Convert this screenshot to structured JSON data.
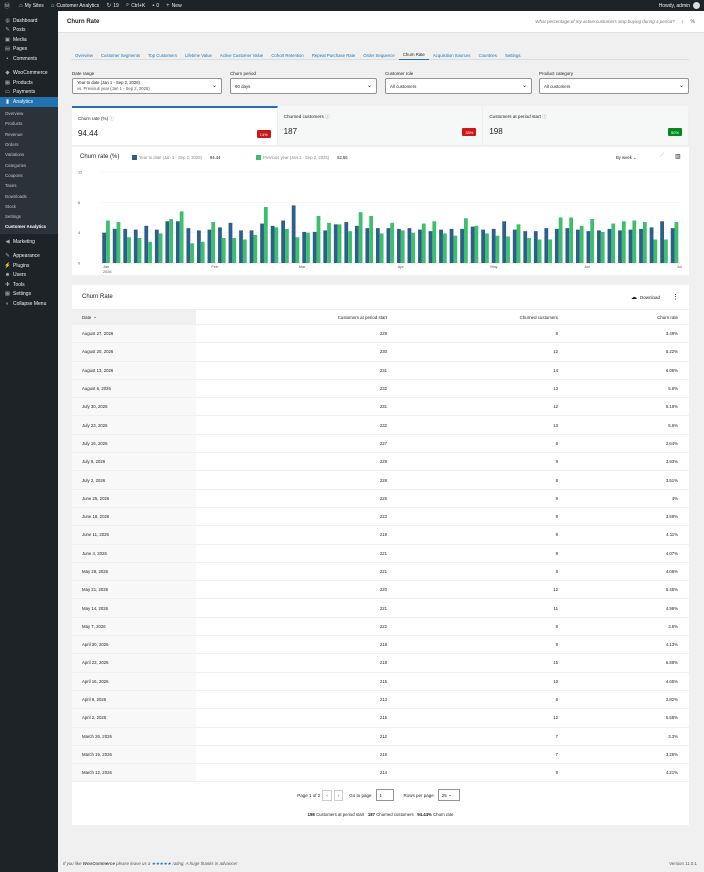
{
  "admin_bar": {
    "my_sites": "My Sites",
    "site_name": "Customer Analytics",
    "updates": "19",
    "search": "Ctrl+K",
    "comments": "0",
    "new": "New",
    "howdy": "Howdy, admin"
  },
  "sidebar": {
    "items": [
      {
        "label": "Dashboard",
        "icon": "dashboard-icon"
      },
      {
        "label": "Posts",
        "icon": "pin-icon"
      },
      {
        "label": "Media",
        "icon": "media-icon"
      },
      {
        "label": "Pages",
        "icon": "page-icon"
      },
      {
        "label": "Comments",
        "icon": "comment-icon"
      },
      {
        "label": "WooCommerce",
        "icon": "woo-icon"
      },
      {
        "label": "Products",
        "icon": "products-icon"
      },
      {
        "label": "Payments",
        "icon": "payments-icon"
      },
      {
        "label": "Analytics",
        "icon": "analytics-icon"
      }
    ],
    "submenu": [
      "Overview",
      "Products",
      "Revenue",
      "Orders",
      "Variations",
      "Categories",
      "Coupons",
      "Taxes",
      "Downloads",
      "Stock",
      "Settings",
      "Customer Analytics"
    ],
    "items2": [
      {
        "label": "Marketing",
        "icon": "megaphone-icon"
      },
      {
        "label": "Appearance",
        "icon": "brush-icon"
      },
      {
        "label": "Plugins",
        "icon": "plugin-icon"
      },
      {
        "label": "Users",
        "icon": "users-icon"
      },
      {
        "label": "Tools",
        "icon": "tools-icon"
      },
      {
        "label": "Settings",
        "icon": "settings-icon"
      },
      {
        "label": "Collapse Menu",
        "icon": "collapse-icon"
      }
    ]
  },
  "header": {
    "title": "Churn Rate",
    "question": "What percentage of my active customers stop buying during a period?"
  },
  "tabs": [
    "Overview",
    "Customer Segments",
    "Top Customers",
    "Lifetime Value",
    "Active Customer Value",
    "Cohort Retention",
    "Repeat Purchase Rate",
    "Order Sequence",
    "Churn Rate",
    "Acquisition Sources",
    "Countries",
    "Settings"
  ],
  "active_tab": "Churn Rate",
  "filters": {
    "date_range": {
      "label": "Date range",
      "line1": "Year to date (Jan 1 - Sep 2, 2026)",
      "line2": "vs. Previous year (Jan 1 - Sep 2, 2025)"
    },
    "churn_period": {
      "label": "Churn period",
      "value": "90 days"
    },
    "customer_role": {
      "label": "Customer role",
      "value": "All customers"
    },
    "product_category": {
      "label": "Product category",
      "value": "All customers"
    }
  },
  "kpis": [
    {
      "label": "Churn rate (%)",
      "value": "94.44",
      "delta": "14%",
      "delta_color": "#cc1818"
    },
    {
      "label": "Churned customers",
      "value": "187",
      "delta": "33%",
      "delta_color": "#cc1818"
    },
    {
      "label": "Customers at period start",
      "value": "198",
      "delta": "50%",
      "delta_color": "#008a20"
    }
  ],
  "chart": {
    "title": "Churn rate (%)",
    "period": "By week",
    "colors": {
      "current": "#2c5f8a",
      "previous": "#3dbf6e"
    }
  },
  "chart_data": {
    "type": "bar",
    "series": [
      {
        "name": "Year to date (Jan 1 - Sep 2, 2026)",
        "total": "94.44",
        "values": [
          4,
          4.5,
          4.5,
          4.4,
          4.9,
          4.4,
          5.5,
          5.5,
          4.6,
          4.3,
          4.4,
          4.7,
          5.3,
          4.3,
          4.3,
          5.2,
          4.9,
          5.6,
          7.6,
          4.1,
          4.1,
          4.3,
          5.1,
          5.4,
          4.9,
          4.6,
          4.6,
          4.6,
          4.5,
          4.6,
          4.4,
          4.2,
          4.4,
          4.5,
          4.5,
          4.8,
          4.4,
          4.5,
          5.5,
          4.4,
          4.2,
          4.2,
          4.6,
          4.5,
          4.6,
          4.4,
          4.2,
          4.3,
          4.5,
          4.3,
          4.4,
          4.5,
          4.7,
          5.5,
          4.6
        ]
      },
      {
        "name": "Previous year (Jan 1 - Sep 2, 2025)",
        "total": "82.56",
        "values": [
          5.6,
          5.4,
          3.4,
          3.3,
          2.8,
          3.9,
          5.8,
          6.8,
          2.6,
          2.8,
          5.4,
          3.3,
          3.3,
          3.1,
          3.7,
          7.4,
          4.7,
          4.5,
          3.4,
          4.0,
          6.2,
          5.3,
          5.1,
          4.2,
          6.7,
          6.2,
          3.9,
          5.3,
          4.3,
          4.0,
          5.2,
          5.5,
          3.9,
          3.6,
          5.9,
          4.9,
          3.9,
          3.6,
          3.5,
          5.1,
          3.3,
          3.1,
          3.1,
          6.0,
          6.0,
          4.9,
          5.8,
          4.1,
          5.2,
          5.5,
          5.6,
          5.4,
          3.1,
          3.1,
          5.4
        ]
      }
    ],
    "x_labels": [
      "Jan\n2026",
      "Feb",
      "Mar",
      "Apr",
      "May",
      "Jun",
      "Jul",
      "Aug"
    ],
    "y_ticks": [
      0,
      4,
      8,
      12
    ],
    "ylim": [
      0,
      12
    ]
  },
  "table": {
    "title": "Churn Rate",
    "download": "Download",
    "columns": [
      "Date",
      "Customers at period start",
      "Churned customers",
      "Churn rate"
    ],
    "rows": [
      [
        "August 27, 2026",
        "229",
        "8",
        "3.49%"
      ],
      [
        "August 20, 2026",
        "230",
        "12",
        "5.22%"
      ],
      [
        "August 13, 2026",
        "231",
        "14",
        "6.06%"
      ],
      [
        "August 6, 2026",
        "232",
        "13",
        "5.6%"
      ],
      [
        "July 30, 2026",
        "231",
        "12",
        "5.19%"
      ],
      [
        "July 23, 2026",
        "232",
        "13",
        "5.6%"
      ],
      [
        "July 16, 2026",
        "227",
        "6",
        "2.64%"
      ],
      [
        "July 9, 2026",
        "229",
        "9",
        "3.93%"
      ],
      [
        "July 2, 2026",
        "228",
        "8",
        "3.51%"
      ],
      [
        "June 25, 2026",
        "225",
        "9",
        "4%"
      ],
      [
        "June 18, 2026",
        "223",
        "8",
        "3.59%"
      ],
      [
        "June 11, 2026",
        "219",
        "9",
        "4.11%"
      ],
      [
        "June 4, 2026",
        "221",
        "9",
        "4.07%"
      ],
      [
        "May 28, 2026",
        "221",
        "9",
        "4.08%"
      ],
      [
        "May 21, 2026",
        "220",
        "12",
        "5.45%"
      ],
      [
        "May 14, 2026",
        "221",
        "11",
        "4.98%"
      ],
      [
        "May 7, 2026",
        "222",
        "8",
        "3.6%"
      ],
      [
        "April 30, 2026",
        "218",
        "9",
        "4.13%"
      ],
      [
        "April 23, 2026",
        "218",
        "15",
        "6.88%"
      ],
      [
        "April 16, 2026",
        "215",
        "10",
        "4.65%"
      ],
      [
        "April 9, 2026",
        "213",
        "6",
        "2.82%"
      ],
      [
        "April 2, 2026",
        "215",
        "12",
        "5.58%"
      ],
      [
        "March 26, 2026",
        "212",
        "7",
        "3.3%"
      ],
      [
        "March 19, 2026",
        "215",
        "7",
        "3.26%"
      ],
      [
        "March 12, 2026",
        "214",
        "9",
        "4.21%"
      ]
    ],
    "pagination": {
      "page_text": "Page 1 of 2",
      "go_to": "Go to page",
      "page_value": "1",
      "rows_per_page": "Rows per page",
      "rows_value": "25"
    },
    "summary": {
      "customers": "198",
      "customers_label": "Customers at period start",
      "churned": "187",
      "churned_label": "Churned customers",
      "rate": "94.44%",
      "rate_label": "Churn rate"
    }
  },
  "footer": {
    "prefix": "If you like ",
    "brand": "WooCommerce",
    "mid": " please leave us a ",
    "stars": "★★★★★",
    "suffix": " rating. A huge thanks in advance!",
    "version": "Version 11.0.1"
  }
}
